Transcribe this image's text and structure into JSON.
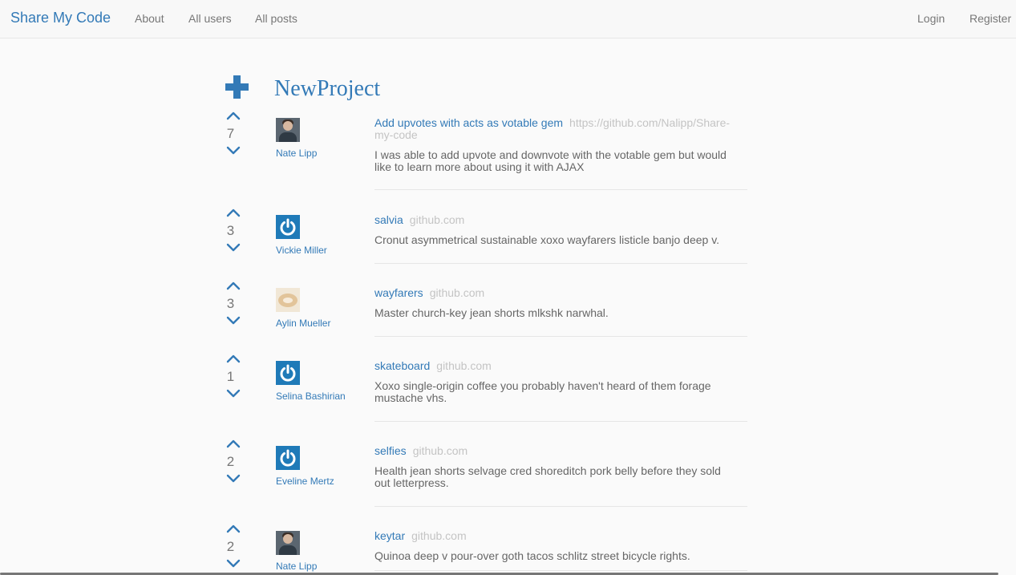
{
  "navbar": {
    "brand": "Share My Code",
    "links": [
      "About",
      "All users",
      "All posts"
    ],
    "login": "Login",
    "register": "Register"
  },
  "new_project": {
    "label": "NewProject",
    "icon": "plus-icon"
  },
  "colors": {
    "accent": "#337ab7",
    "url_gray": "#c4c4c4",
    "power_avatar": "#1f7ab8"
  },
  "posts": [
    {
      "votes": "7",
      "user": "Nate Lipp",
      "avatar": "photo",
      "title": "Add upvotes with acts as votable gem",
      "url": "https://github.com/Nalipp/Share-my-code",
      "desc": "I was able to add upvote and downvote with the votable gem but would like to learn more about using it with AJAX"
    },
    {
      "votes": "3",
      "user": "Vickie Miller",
      "avatar": "power",
      "title": "salvia",
      "url": "github.com",
      "desc": "Cronut asymmetrical sustainable xoxo wayfarers listicle banjo deep v."
    },
    {
      "votes": "3",
      "user": "Aylin Mueller",
      "avatar": "bread",
      "title": "wayfarers",
      "url": "github.com",
      "desc": "Master church-key jean shorts mlkshk narwhal."
    },
    {
      "votes": "1",
      "user": "Selina Bashirian",
      "avatar": "power",
      "title": "skateboard",
      "url": "github.com",
      "desc": "Xoxo single-origin coffee you probably haven't heard of them forage mustache vhs."
    },
    {
      "votes": "2",
      "user": "Eveline Mertz",
      "avatar": "power",
      "title": "selfies",
      "url": "github.com",
      "desc": "Health jean shorts selvage cred shoreditch pork belly before they sold out letterpress."
    },
    {
      "votes": "2",
      "user": "Nate Lipp",
      "avatar": "photo",
      "title": "keytar",
      "url": "github.com",
      "desc": "Quinoa deep v pour-over goth tacos schlitz street bicycle rights."
    }
  ]
}
